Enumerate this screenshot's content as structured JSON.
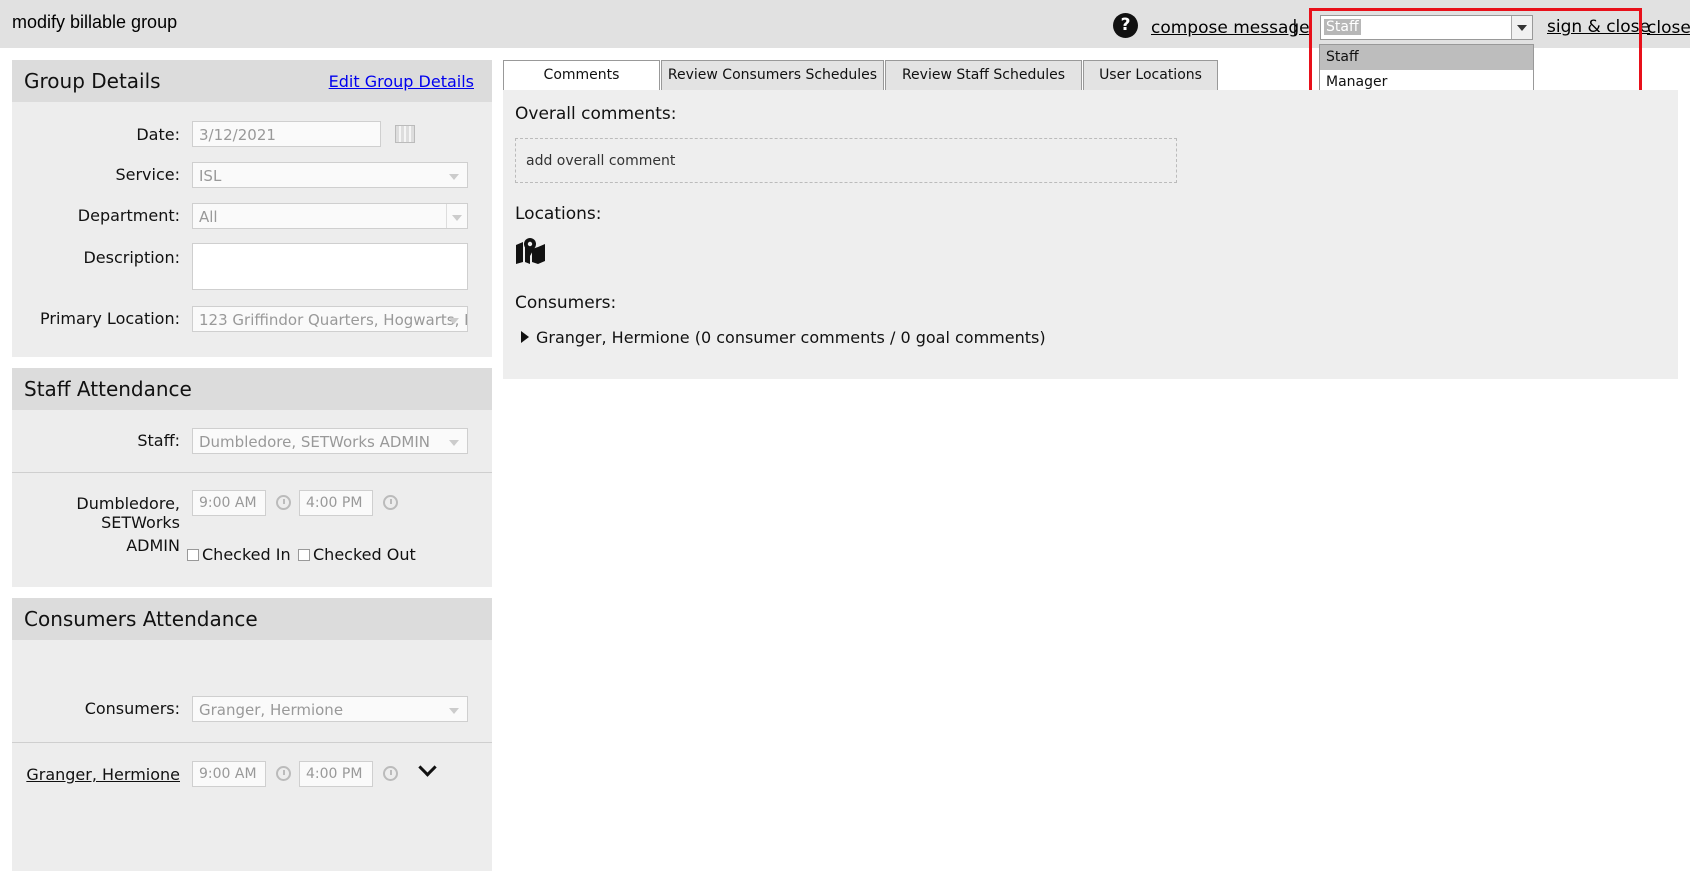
{
  "header": {
    "title": "modify billable group",
    "help_glyph": "?",
    "compose_label": "compose message",
    "separator": "|",
    "sign_close_label": "sign & close",
    "close_label": "close"
  },
  "role_select": {
    "value": "Staff",
    "options": [
      "Staff",
      "Manager"
    ]
  },
  "group_details": {
    "title": "Group Details",
    "edit_link": "Edit Group Details",
    "date_label": "Date:",
    "date_value": "3/12/2021",
    "service_label": "Service:",
    "service_value": "ISL",
    "department_label": "Department:",
    "department_value": "All",
    "description_label": "Description:",
    "description_value": "",
    "primary_location_label": "Primary Location:",
    "primary_location_value": "123 Griffindor Quarters, Hogwarts, I"
  },
  "staff_attendance": {
    "title": "Staff Attendance",
    "staff_label": "Staff:",
    "staff_value": "Dumbledore, SETWorks ADMIN",
    "row_name_line1": "Dumbledore, SETWorks",
    "row_name_line2": "ADMIN",
    "start_time": "9:00 AM",
    "end_time": "4:00 PM",
    "checked_in_label": "Checked In",
    "checked_out_label": "Checked Out"
  },
  "consumers_attendance": {
    "title": "Consumers Attendance",
    "consumers_label": "Consumers:",
    "consumers_value": "Granger, Hermione",
    "row_name": "Granger, Hermione",
    "start_time": "9:00 AM",
    "end_time": "4:00 PM"
  },
  "tabs": [
    {
      "label": "Comments"
    },
    {
      "label": "Review Consumers Schedules"
    },
    {
      "label": "Review Staff Schedules"
    },
    {
      "label": "User Locations"
    }
  ],
  "comments": {
    "overall_title": "Overall comments:",
    "add_placeholder": "add overall comment",
    "locations_title": "Locations:",
    "consumers_title": "Consumers:",
    "consumer_entry": "Granger, Hermione (0 consumer comments / 0  goal comments)"
  },
  "colors": {
    "highlight_box": "#e8101a",
    "link": "#0000ee",
    "panel_bg": "#ededed",
    "header_bg": "#e1e1e1"
  },
  "icons": [
    "help-icon",
    "calendar-icon",
    "dropdown-arrow-icon",
    "clock-icon",
    "map-icon",
    "triangle-right-icon",
    "chevron-down-icon"
  ]
}
